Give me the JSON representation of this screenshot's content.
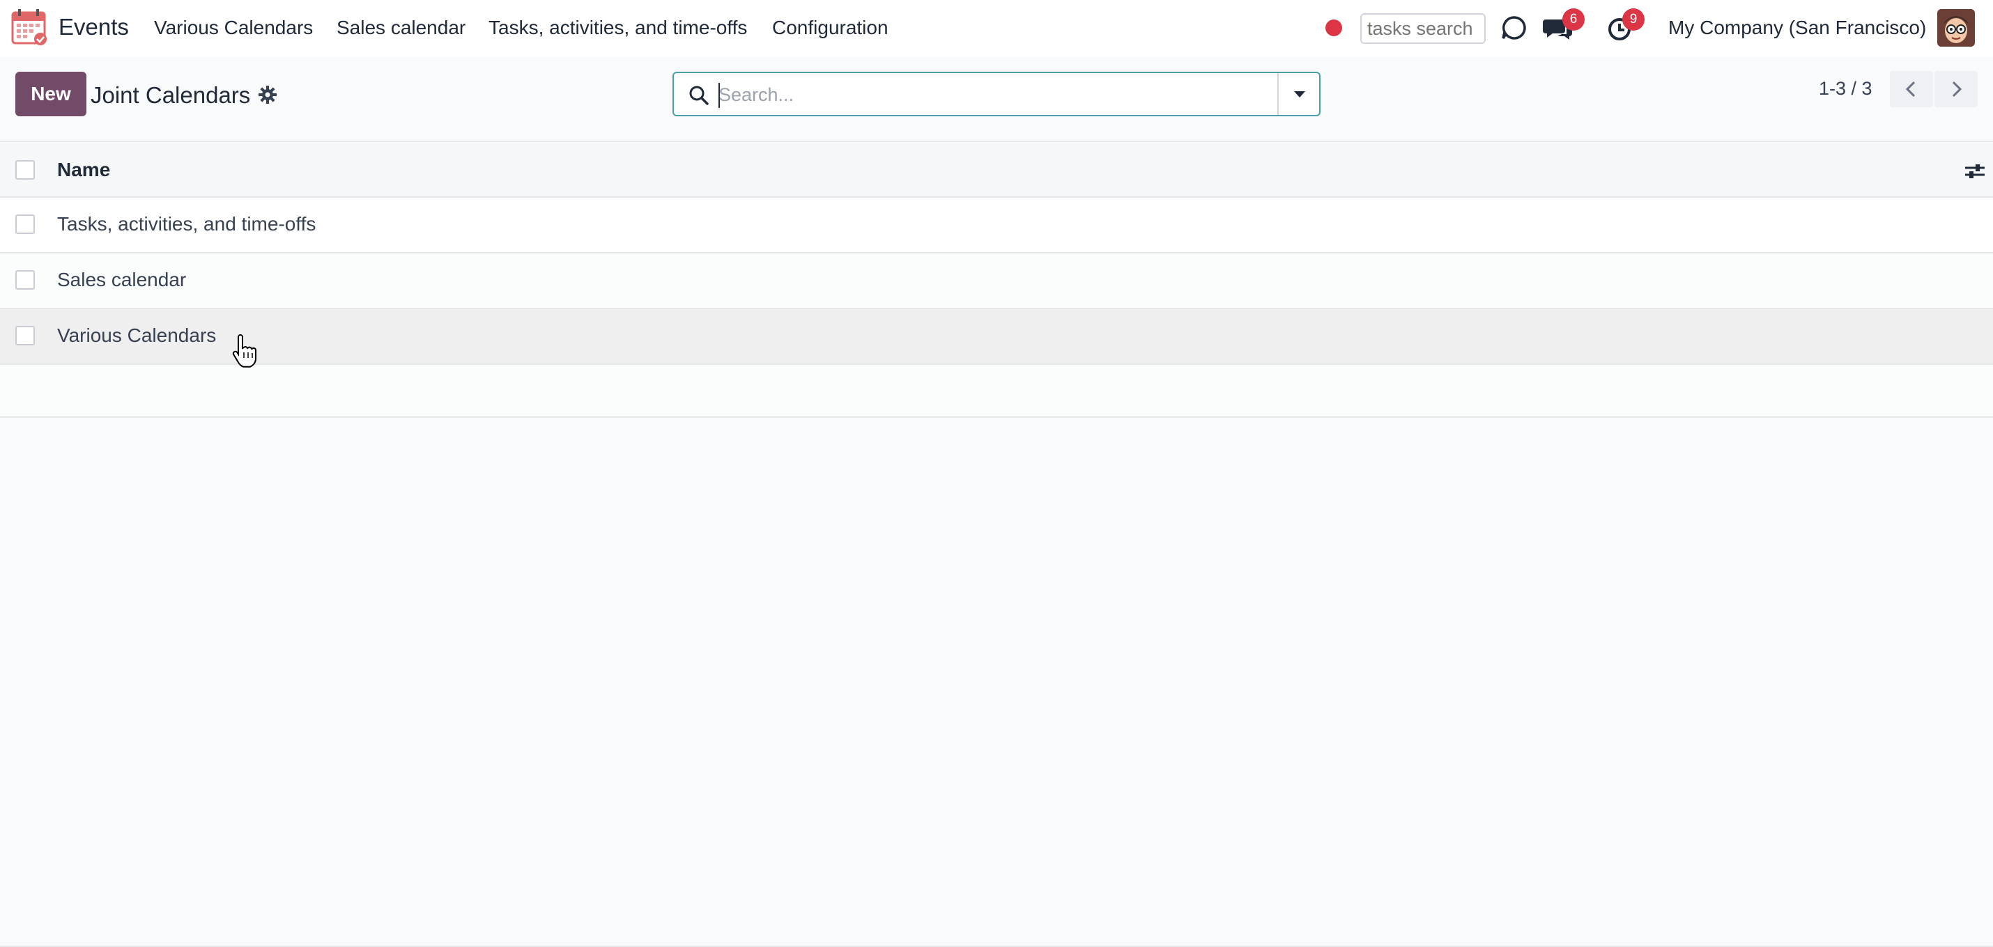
{
  "navbar": {
    "app_name": "Events",
    "menus": [
      "Various Calendars",
      "Sales calendar",
      "Tasks, activities, and time-offs",
      "Configuration"
    ],
    "search_placeholder": "tasks search",
    "messages_count": "6",
    "activities_count": "9",
    "company": "My Company (San Francisco)"
  },
  "control": {
    "new_label": "New",
    "title": "Joint Calendars",
    "search_placeholder": "Search...",
    "pager": "1-3 / 3"
  },
  "table": {
    "header_name": "Name",
    "rows": [
      "Tasks, activities, and time-offs",
      "Sales calendar",
      "Various Calendars"
    ]
  },
  "colors": {
    "brand": "#714b67",
    "badge": "#dc3545",
    "search_border": "#4c9fa8"
  }
}
